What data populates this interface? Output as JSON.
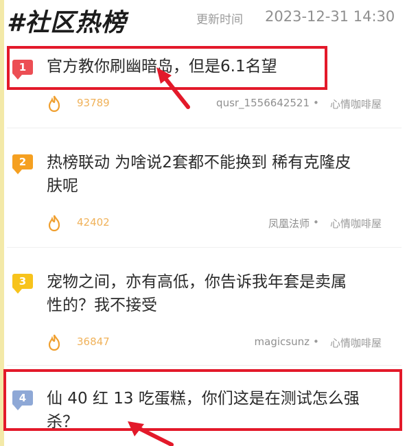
{
  "header": {
    "title": "#社区热榜",
    "update_label": "更新时间",
    "update_time": "2023-12-31 14:30"
  },
  "items": [
    {
      "rank": "1",
      "title": "官方教你刷幽暗岛，但是6.1名望",
      "heat": "93789",
      "author": "qusr_1556642521",
      "source": "心情咖啡屋"
    },
    {
      "rank": "2",
      "title": "热榜联动 为啥说2套都不能换到 稀有克隆皮\n肤呢",
      "heat": "42402",
      "author": "凤凰法师",
      "source": "心情咖啡屋"
    },
    {
      "rank": "3",
      "title": "宠物之间，亦有高低，你告诉我年套是卖属\n性的？我不接受",
      "heat": "36847",
      "author": "magicsunz",
      "source": "心情咖啡屋"
    },
    {
      "rank": "4",
      "title": "仙 40 红 13 吃蛋糕，你们这是在测试怎么强\n杀？",
      "heat": "",
      "author": "",
      "source": ""
    }
  ],
  "separator": "•",
  "colors": {
    "rank1": "#ec4e54",
    "rank2": "#f5a021",
    "rank3": "#f7c31c",
    "rank4": "#8ea8d6",
    "heat": "#f0b25a",
    "annotation": "#e3192a"
  },
  "icons": {
    "heat": "flame-icon"
  }
}
